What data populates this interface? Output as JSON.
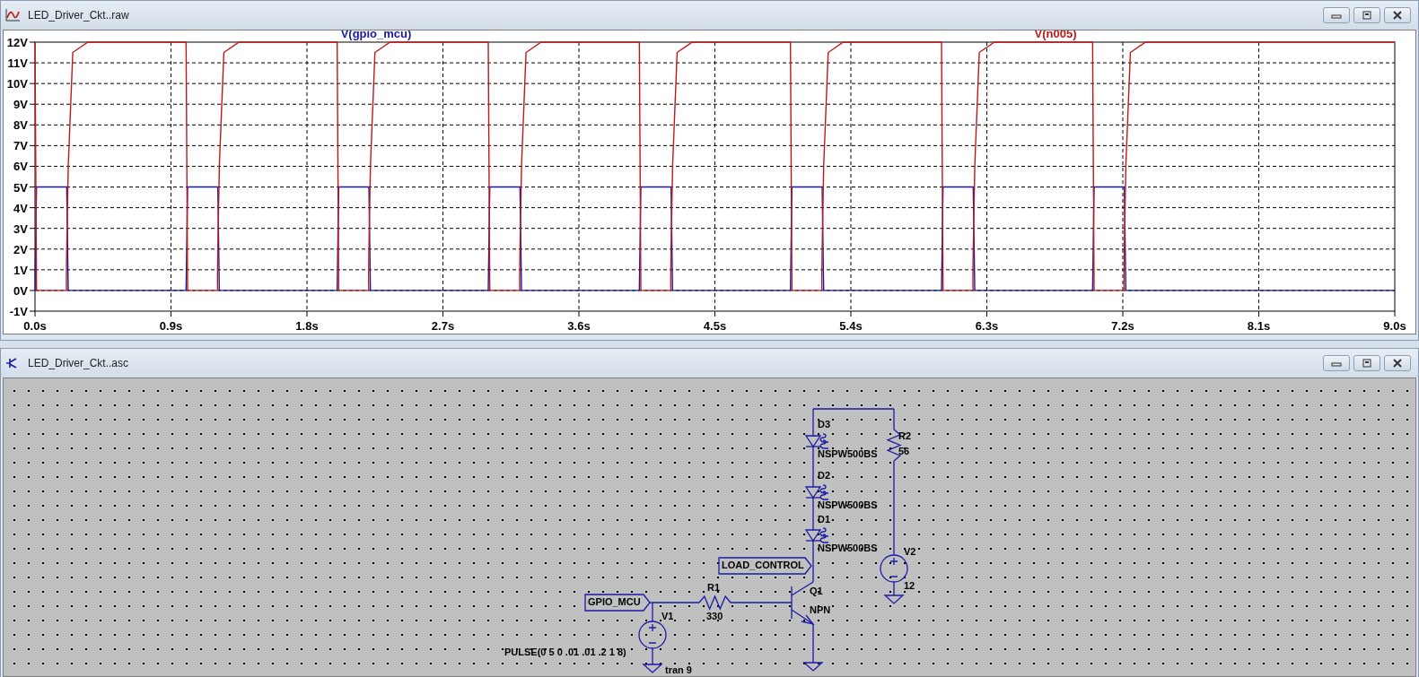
{
  "windows": [
    {
      "kind": "waveform",
      "title": "LED_Driver_Ckt..raw",
      "chart_data": {
        "type": "line",
        "x": [
          0,
          0.01,
          0.21,
          0.22,
          0.25,
          0.35,
          1,
          1.01,
          1.21,
          1.22,
          1.25,
          1.35,
          2,
          2.01,
          2.21,
          2.22,
          2.25,
          2.35,
          3,
          3.01,
          3.21,
          3.22,
          3.25,
          3.35,
          4,
          4.01,
          4.21,
          4.22,
          4.25,
          4.35,
          5,
          5.01,
          5.21,
          5.22,
          5.25,
          5.35,
          6,
          6.01,
          6.21,
          6.22,
          6.25,
          6.35,
          7,
          7.01,
          7.21,
          7.22,
          7.25,
          7.35,
          9
        ],
        "series": [
          {
            "name": "V(gpio_mcu)",
            "color": "#1a1aa8",
            "values": [
              0,
              5,
              5,
              0,
              0,
              0,
              0,
              5,
              5,
              0,
              0,
              0,
              0,
              5,
              5,
              0,
              0,
              0,
              0,
              5,
              5,
              0,
              0,
              0,
              0,
              5,
              5,
              0,
              0,
              0,
              0,
              5,
              5,
              0,
              0,
              0,
              0,
              5,
              5,
              0,
              0,
              0,
              0,
              5,
              5,
              0,
              0,
              0,
              0
            ]
          },
          {
            "name": "V(n005)",
            "color": "#c01818",
            "values": [
              12,
              0,
              0,
              6,
              11.5,
              12,
              12,
              0,
              0,
              6,
              11.5,
              12,
              12,
              0,
              0,
              6,
              11.5,
              12,
              12,
              0,
              0,
              6,
              11.5,
              12,
              12,
              0,
              0,
              6,
              11.5,
              12,
              12,
              0,
              0,
              6,
              11.5,
              12,
              12,
              0,
              0,
              6,
              11.5,
              12,
              12,
              0,
              0,
              6,
              11.5,
              12,
              12
            ]
          }
        ],
        "xlim": [
          0,
          9
        ],
        "ylim": [
          -1,
          12
        ],
        "grid": true,
        "xticks": [
          {
            "value": 0,
            "label": "0.0s"
          },
          {
            "value": 0.9,
            "label": "0.9s"
          },
          {
            "value": 1.8,
            "label": "1.8s"
          },
          {
            "value": 2.7,
            "label": "2.7s"
          },
          {
            "value": 3.6,
            "label": "3.6s"
          },
          {
            "value": 4.5,
            "label": "4.5s"
          },
          {
            "value": 5.4,
            "label": "5.4s"
          },
          {
            "value": 6.3,
            "label": "6.3s"
          },
          {
            "value": 7.2,
            "label": "7.2s"
          },
          {
            "value": 8.1,
            "label": "8.1s"
          },
          {
            "value": 9,
            "label": "9.0s"
          }
        ],
        "yticks": [
          {
            "value": 12,
            "label": "12V"
          },
          {
            "value": 11,
            "label": "11V"
          },
          {
            "value": 10,
            "label": "10V"
          },
          {
            "value": 9,
            "label": "9V"
          },
          {
            "value": 8,
            "label": "8V"
          },
          {
            "value": 7,
            "label": "7V"
          },
          {
            "value": 6,
            "label": "6V"
          },
          {
            "value": 5,
            "label": "5V"
          },
          {
            "value": 4,
            "label": "4V"
          },
          {
            "value": 3,
            "label": "3V"
          },
          {
            "value": 2,
            "label": "2V"
          },
          {
            "value": 1,
            "label": "1V"
          },
          {
            "value": 0,
            "label": "0V"
          },
          {
            "value": -1,
            "label": "-1V"
          }
        ]
      }
    },
    {
      "kind": "schematic",
      "title": "LED_Driver_Ckt..asc",
      "components": [
        {
          "kind": "led",
          "ref": "D3",
          "value": "NSPW500BS"
        },
        {
          "kind": "led",
          "ref": "D2",
          "value": "NSPW500BS"
        },
        {
          "kind": "led",
          "ref": "D1",
          "value": "NSPW500BS"
        },
        {
          "kind": "resistor",
          "ref": "R2",
          "value": "56"
        },
        {
          "kind": "source",
          "ref": "V2",
          "value": "12"
        },
        {
          "kind": "resistor",
          "ref": "R1",
          "value": "330"
        },
        {
          "kind": "npn",
          "ref": "Q1",
          "value": "NPN"
        },
        {
          "kind": "source",
          "ref": "V1",
          "value": "PULSE(0 5 0 .01 .01 .2 1 8)"
        }
      ],
      "net_labels": [
        "LOAD_CONTROL",
        "GPIO_MCU"
      ],
      "directives": [
        "tran 9"
      ]
    }
  ]
}
